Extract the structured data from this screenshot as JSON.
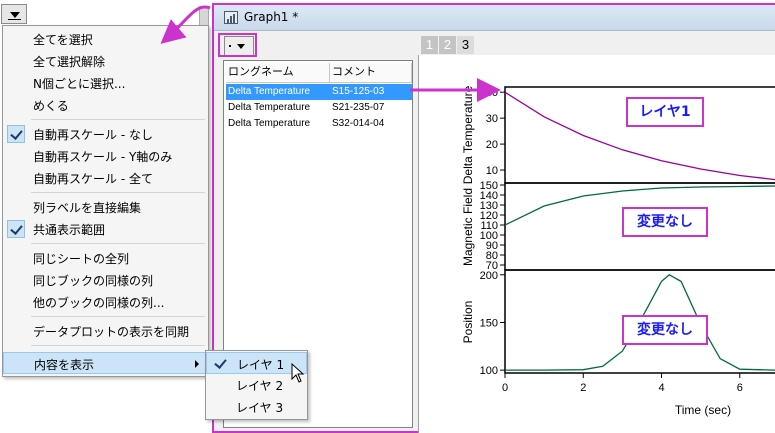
{
  "menu": {
    "items": [
      {
        "label": "全てを選択",
        "checked": false
      },
      {
        "label": "全て選択解除",
        "checked": false
      },
      {
        "label": "N個ごとに選択...",
        "checked": false
      },
      {
        "label": "めくる",
        "checked": false
      },
      {
        "label": "自動再スケール - なし",
        "checked": true
      },
      {
        "label": "自動再スケール - Y軸のみ",
        "checked": false
      },
      {
        "label": "自動再スケール - 全て",
        "checked": false
      },
      {
        "label": "列ラベルを直接編集",
        "checked": false
      },
      {
        "label": "共通表示範囲",
        "checked": true
      },
      {
        "label": "同じシートの全列",
        "checked": false
      },
      {
        "label": "同じブックの同様の列",
        "checked": false
      },
      {
        "label": "他のブックの同様の列...",
        "checked": false
      },
      {
        "label": "データプロットの表示を同期",
        "checked": false
      },
      {
        "label": "内容を表示",
        "checked": false,
        "submenu": true
      }
    ],
    "submenu": [
      {
        "label": "レイヤ 1",
        "checked": true
      },
      {
        "label": "レイヤ 2",
        "checked": false
      },
      {
        "label": "レイヤ 3",
        "checked": false
      }
    ]
  },
  "window": {
    "title": "Graph1 *",
    "layer_tabs": [
      "1",
      "2",
      "3"
    ],
    "active_layer_tab": "3"
  },
  "data_list": {
    "columns": [
      "ロングネーム",
      "コメント"
    ],
    "rows": [
      {
        "name": "Delta Temperature",
        "comment": "S15-125-03",
        "selected": true
      },
      {
        "name": "Delta Temperature",
        "comment": "S21-235-07",
        "selected": false
      },
      {
        "name": "Delta Temperature",
        "comment": "S32-014-04",
        "selected": false
      }
    ]
  },
  "annotations": {
    "layer1": "レイヤ1",
    "unchanged_1": "変更なし",
    "unchanged_2": "変更なし"
  },
  "chart_data": {
    "type": "line",
    "x_label": "Time (sec)",
    "x_ticks": [
      "0",
      "2",
      "4",
      "6"
    ],
    "xlim": [
      0,
      6.9
    ],
    "panels": [
      {
        "name": "layer-1",
        "ylabel": "Delta Temperature",
        "ylim": [
          5,
          42
        ],
        "y_ticks": [
          "10",
          "20",
          "30",
          "40"
        ],
        "color": "#9b009b",
        "x": [
          0,
          1,
          2,
          3,
          4,
          5,
          6,
          6.9
        ],
        "y": [
          40,
          30.5,
          23.3,
          17.8,
          13.6,
          10.4,
          7.9,
          6.3
        ]
      },
      {
        "name": "layer-2",
        "ylabel": "Magnetic Field",
        "ylim": [
          65,
          152
        ],
        "y_ticks": [
          "70",
          "80",
          "90",
          "100",
          "110",
          "120",
          "130",
          "140",
          "150"
        ],
        "color": "#006b3c",
        "x": [
          0,
          1,
          2,
          3,
          4,
          5,
          6,
          6.9
        ],
        "y": [
          110,
          129,
          139,
          144,
          147,
          148,
          148.5,
          149
        ]
      },
      {
        "name": "layer-3",
        "ylabel": "Position",
        "ylim": [
          97,
          205
        ],
        "y_ticks": [
          "100",
          "150",
          "200"
        ],
        "color": "#006b3c",
        "x": [
          0,
          1,
          2,
          2.5,
          3,
          3.5,
          4,
          4.2,
          4.5,
          5,
          5.5,
          6,
          6.9
        ],
        "y": [
          100,
          100,
          100.5,
          104,
          120,
          155,
          193,
          200,
          193,
          148,
          112,
          101,
          100
        ]
      }
    ]
  }
}
